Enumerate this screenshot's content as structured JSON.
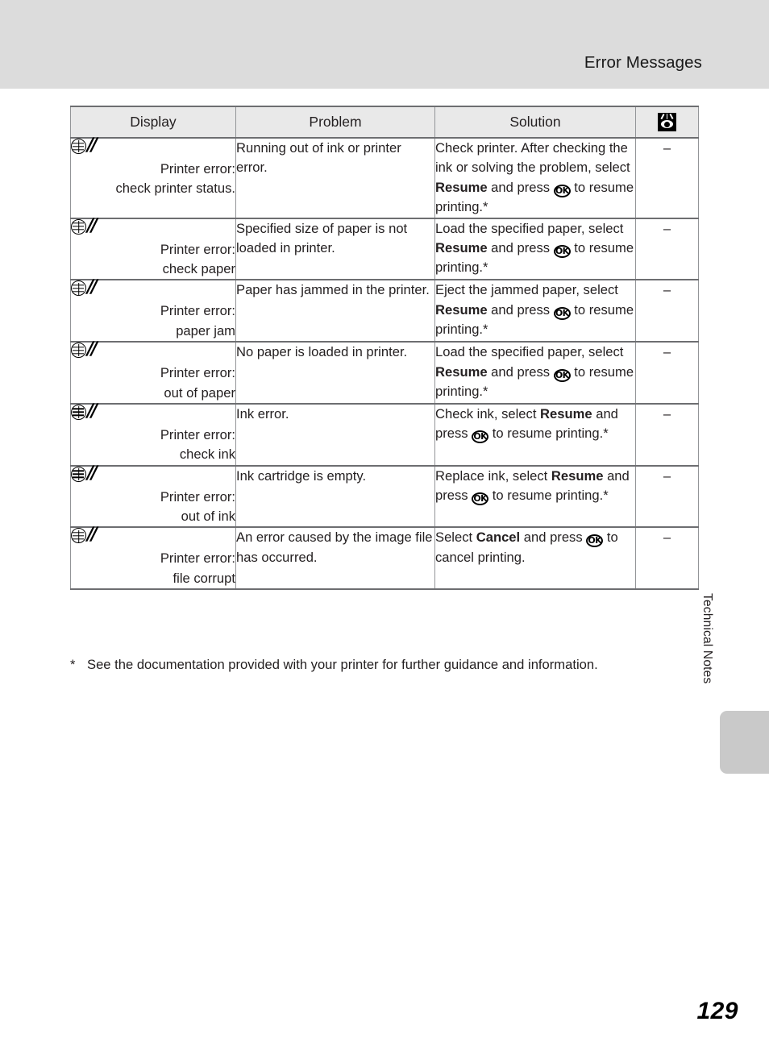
{
  "header": {
    "title": "Error Messages"
  },
  "table": {
    "columns": [
      {
        "key": "display",
        "label": "Display"
      },
      {
        "key": "problem",
        "label": "Problem"
      },
      {
        "key": "solution",
        "label": "Solution"
      },
      {
        "key": "ref",
        "label": "",
        "icon": "eye-icon"
      }
    ],
    "rows": [
      {
        "display_icons": [
          "globe-icon",
          "error-slash-icon"
        ],
        "display_lines": [
          "Printer error:",
          "check printer status."
        ],
        "problem": "Running out of ink or printer error.",
        "solution_parts": [
          {
            "type": "text",
            "value": "Check printer. After checking the ink or solving the problem, select "
          },
          {
            "type": "bold",
            "value": "Resume"
          },
          {
            "type": "text",
            "value": " and press "
          },
          {
            "type": "icon",
            "value": "ok-button-icon",
            "label": "OK"
          },
          {
            "type": "text",
            "value": " to resume printing.*"
          }
        ],
        "ref": "–"
      },
      {
        "display_icons": [
          "globe-icon",
          "error-slash-icon"
        ],
        "display_lines": [
          "Printer error:",
          "check paper"
        ],
        "problem": "Specified size of paper is not loaded in printer.",
        "solution_parts": [
          {
            "type": "text",
            "value": "Load the specified paper, select "
          },
          {
            "type": "bold",
            "value": "Resume"
          },
          {
            "type": "text",
            "value": " and press "
          },
          {
            "type": "icon",
            "value": "ok-button-icon",
            "label": "OK"
          },
          {
            "type": "text",
            "value": " to resume printing.*"
          }
        ],
        "ref": "–"
      },
      {
        "display_icons": [
          "globe-icon",
          "error-slash-icon"
        ],
        "display_lines": [
          "Printer error:",
          "paper jam"
        ],
        "problem": "Paper has jammed in the printer.",
        "solution_parts": [
          {
            "type": "text",
            "value": "Eject the jammed paper, select "
          },
          {
            "type": "bold",
            "value": "Resume"
          },
          {
            "type": "text",
            "value": " and press "
          },
          {
            "type": "icon",
            "value": "ok-button-icon",
            "label": "OK"
          },
          {
            "type": "text",
            "value": " to resume printing.*"
          }
        ],
        "ref": "–"
      },
      {
        "display_icons": [
          "globe-icon",
          "error-slash-icon"
        ],
        "display_lines": [
          "Printer error:",
          "out of paper"
        ],
        "problem": "No paper is loaded in printer.",
        "solution_parts": [
          {
            "type": "text",
            "value": "Load the specified paper, select "
          },
          {
            "type": "bold",
            "value": "Resume"
          },
          {
            "type": "text",
            "value": " and press "
          },
          {
            "type": "icon",
            "value": "ok-button-icon",
            "label": "OK"
          },
          {
            "type": "text",
            "value": " to resume printing.*"
          }
        ],
        "ref": "–"
      },
      {
        "display_icons": [
          "globe-icon",
          "error-slash-icon"
        ],
        "display_lines": [
          "Printer error:",
          "check ink"
        ],
        "problem": "Ink error.",
        "solution_parts": [
          {
            "type": "text",
            "value": "Check ink, select "
          },
          {
            "type": "bold",
            "value": "Resume"
          },
          {
            "type": "text",
            "value": " and press "
          },
          {
            "type": "icon",
            "value": "ok-button-icon",
            "label": "OK"
          },
          {
            "type": "text",
            "value": " to resume printing.*"
          }
        ],
        "ref": "–"
      },
      {
        "display_icons": [
          "globe-icon",
          "error-slash-icon"
        ],
        "display_lines": [
          "Printer error:",
          "out of ink"
        ],
        "problem": "Ink cartridge is empty.",
        "solution_parts": [
          {
            "type": "text",
            "value": "Replace ink, select "
          },
          {
            "type": "bold",
            "value": "Resume"
          },
          {
            "type": "text",
            "value": " and press "
          },
          {
            "type": "icon",
            "value": "ok-button-icon",
            "label": "OK"
          },
          {
            "type": "text",
            "value": " to resume printing.*"
          }
        ],
        "ref": "–"
      },
      {
        "display_icons": [
          "globe-icon",
          "error-slash-icon"
        ],
        "display_lines": [
          "Printer error:",
          "file corrupt"
        ],
        "problem": "An error caused by the image file has occurred.",
        "solution_parts": [
          {
            "type": "text",
            "value": "Select "
          },
          {
            "type": "bold",
            "value": "Cancel"
          },
          {
            "type": "text",
            "value": " and press "
          },
          {
            "type": "icon",
            "value": "ok-button-icon",
            "label": "OK"
          },
          {
            "type": "text",
            "value": " to cancel printing."
          }
        ],
        "ref": "–"
      }
    ]
  },
  "footnote": {
    "marker": "*",
    "text": "See the documentation provided with your printer for further guidance and information."
  },
  "side_tab": {
    "label": "Technical Notes",
    "color": "#c9c9c9"
  },
  "page": {
    "number": "129"
  },
  "colors": {
    "header_band": "#dcdcdc",
    "table_header_fill": "#e9e9e9",
    "rule_strong": "#6d6e71",
    "rule_light": "#939598",
    "text": "#231f20"
  }
}
